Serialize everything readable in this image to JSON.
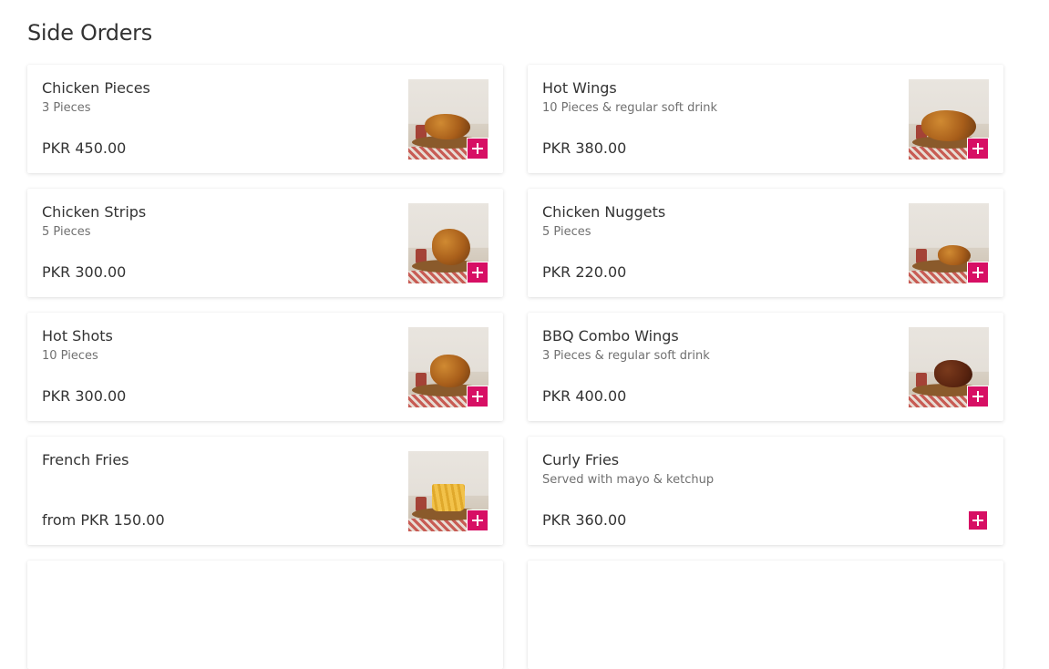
{
  "section": {
    "title": "Side Orders"
  },
  "colors": {
    "accent": "#d70f64",
    "text": "#333333",
    "muted": "#707070"
  },
  "items": [
    {
      "name": "Chicken Pieces",
      "description": "3 Pieces",
      "price": "PKR 450.00",
      "image": "fried-chicken-photo"
    },
    {
      "name": "Hot Wings",
      "description": "10 Pieces & regular soft drink",
      "price": "PKR 380.00",
      "image": "hot-wings-photo"
    },
    {
      "name": "Chicken Strips",
      "description": "5 Pieces",
      "price": "PKR 300.00",
      "image": "chicken-strips-photo"
    },
    {
      "name": "Chicken Nuggets",
      "description": "5 Pieces",
      "price": "PKR 220.00",
      "image": "chicken-nuggets-photo"
    },
    {
      "name": "Hot Shots",
      "description": "10 Pieces",
      "price": "PKR 300.00",
      "image": "hot-shots-photo"
    },
    {
      "name": "BBQ Combo Wings",
      "description": "3 Pieces & regular soft drink",
      "price": "PKR 400.00",
      "image": "bbq-wings-photo"
    },
    {
      "name": "French Fries",
      "description": "",
      "price": "from PKR 150.00",
      "image": "french-fries-photo"
    },
    {
      "name": "Curly Fries",
      "description": "Served with mayo & ketchup",
      "price": "PKR 360.00",
      "image": ""
    }
  ],
  "add_button_icon": "plus-icon"
}
